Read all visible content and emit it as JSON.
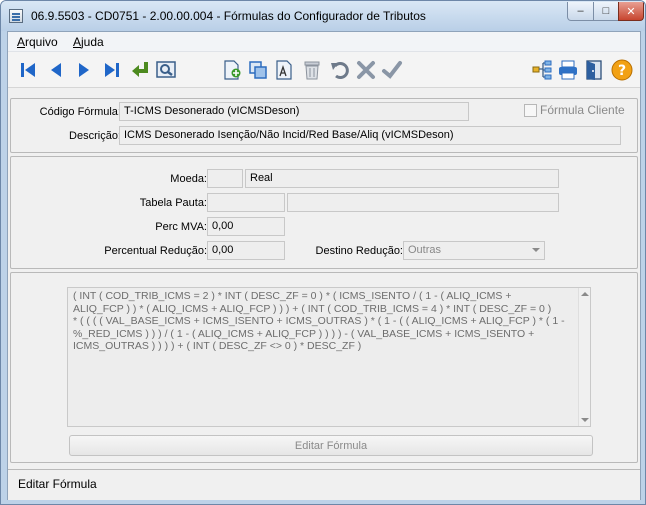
{
  "window": {
    "title": "06.9.5503 - CD0751 - 2.00.00.004 - Fórmulas do Configurador de Tributos",
    "minimize_glyph": "–",
    "maximize_glyph": "□",
    "close_glyph": "✕"
  },
  "menu": {
    "items": [
      {
        "accel": "A",
        "rest": "rquivo"
      },
      {
        "accel": "A",
        "rest": "juda"
      }
    ]
  },
  "toolbar": {
    "buttons": [
      "first-icon",
      "previous-icon",
      "next-icon",
      "last-icon",
      "select-return-icon",
      "search-icon",
      "new-icon",
      "copy-icon",
      "edit-icon",
      "delete-icon",
      "undo-icon",
      "cancel-icon",
      "confirm-icon",
      "tree-icon",
      "print-icon",
      "exit-icon",
      "help-icon"
    ]
  },
  "header": {
    "codigo_label": "Código Fórmula:",
    "codigo_value": "T-ICMS Desonerado (vICMSDeson)",
    "cliente_label": "Fórmula Cliente",
    "descricao_label": "Descrição:",
    "descricao_value": "ICMS Desonerado Isenção/Não Incid/Red Base/Aliq  (vICMSDeson)"
  },
  "params": {
    "moeda_label": "Moeda:",
    "moeda_code": "",
    "moeda_value": "Real",
    "tabela_label": "Tabela Pauta:",
    "tabela_code": "",
    "tabela_value": "",
    "perc_mva_label": "Perc MVA:",
    "perc_mva_value": "0,00",
    "perc_red_label": "Percentual Redução:",
    "perc_red_value": "0,00",
    "destino_label": "Destino Redução:",
    "destino_value": "Outras"
  },
  "formula": {
    "text": "( INT ( COD_TRIB_ICMS = 2 ) * INT ( DESC_ZF = 0 ) * ( ICMS_ISENTO / ( 1 - ( ALIQ_ICMS +\nALIQ_FCP ) ) * ( ALIQ_ICMS + ALIQ_FCP ) ) ) + ( INT ( COD_TRIB_ICMS = 4 ) * INT ( DESC_ZF = 0 )\n* ( ( ( ( VAL_BASE_ICMS + ICMS_ISENTO + ICMS_OUTRAS ) * ( 1 - ( ( ALIQ_ICMS + ALIQ_FCP ) * ( 1 -\n%_RED_ICMS ) ) ) / ( 1 - ( ALIQ_ICMS + ALIQ_FCP ) ) ) ) - ( VAL_BASE_ICMS + ICMS_ISENTO +\nICMS_OUTRAS ) ) ) ) + ( INT ( DESC_ZF <> 0 ) * DESC_ZF )",
    "edit_button": "Editar Fórmula"
  },
  "status": {
    "text": "Editar Fórmula"
  }
}
